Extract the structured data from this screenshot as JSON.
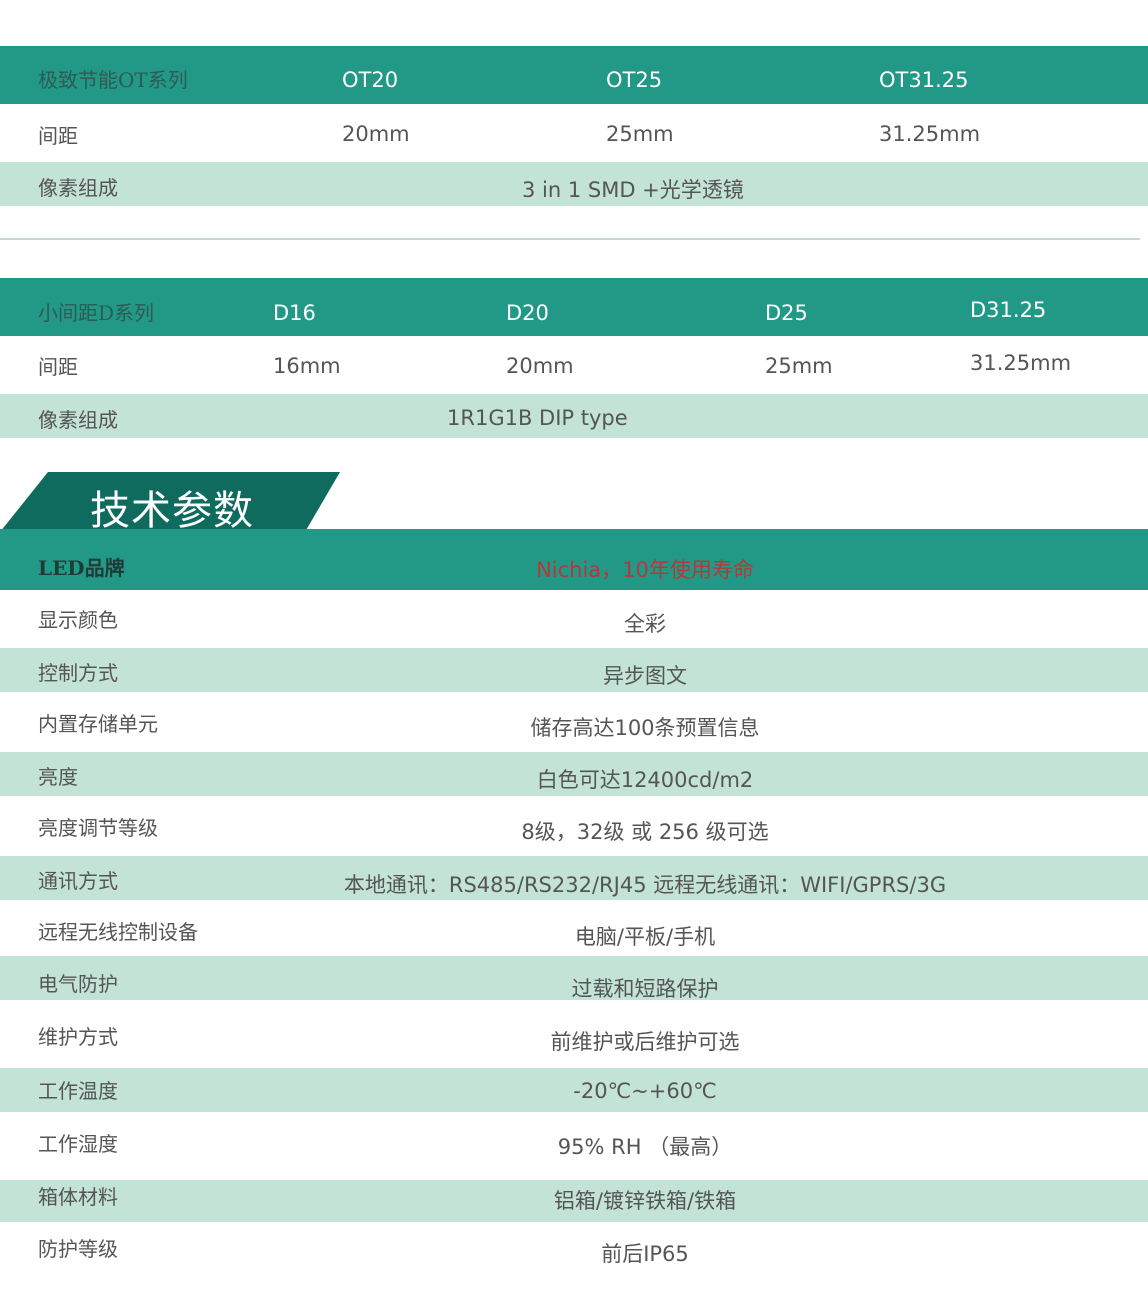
{
  "ot_table": {
    "header": [
      "极致节能OT系列",
      "OT20",
      "OT25",
      "OT31.25"
    ],
    "spacing": [
      "间距",
      "20mm",
      "25mm",
      "31.25mm"
    ],
    "pixel_label": "像素组成",
    "pixel_value": "3 in 1 SMD +光学透镜"
  },
  "d_table": {
    "header": [
      "小间距D系列",
      "D16",
      "D20",
      "D25",
      "D31.25"
    ],
    "spacing": [
      "间距",
      "16mm",
      "20mm",
      "25mm",
      "31.25mm"
    ],
    "pixel_label": "像素组成",
    "pixel_value": "1R1G1B DIP type"
  },
  "tech_section": {
    "title": "技术参数",
    "rows": [
      {
        "label": "LED品牌",
        "value": "Nichia，10年使用寿命"
      },
      {
        "label": "显示颜色",
        "value": "全彩"
      },
      {
        "label": "控制方式",
        "value": "异步图文"
      },
      {
        "label": "内置存储单元",
        "value": "储存高达100条预置信息"
      },
      {
        "label": "亮度",
        "value": "白色可达12400cd/m2"
      },
      {
        "label": "亮度调节等级",
        "value": "8级，32级 或 256 级可选"
      },
      {
        "label": "通讯方式",
        "value": "本地通讯：RS485/RS232/RJ45   远程无线通讯：WIFI/GPRS/3G"
      },
      {
        "label": "远程无线控制设备",
        "value": "电脑/平板/手机"
      },
      {
        "label": "电气防护",
        "value": "过载和短路保护"
      },
      {
        "label": "维护方式",
        "value": "前维护或后维护可选"
      },
      {
        "label": "工作温度",
        "value": "-20℃~+60℃"
      },
      {
        "label": "工作湿度",
        "value": "95% RH （最高）"
      },
      {
        "label": "箱体材料",
        "value": "铝箱/镀锌铁箱/铁箱"
      },
      {
        "label": "防护等级",
        "value": "前后IP65"
      }
    ]
  },
  "colors": {
    "header_teal": "#229987",
    "light_band": "#c3e3d7",
    "title_dark": "#0f6b5e",
    "brand_value": "#b23a3a"
  }
}
